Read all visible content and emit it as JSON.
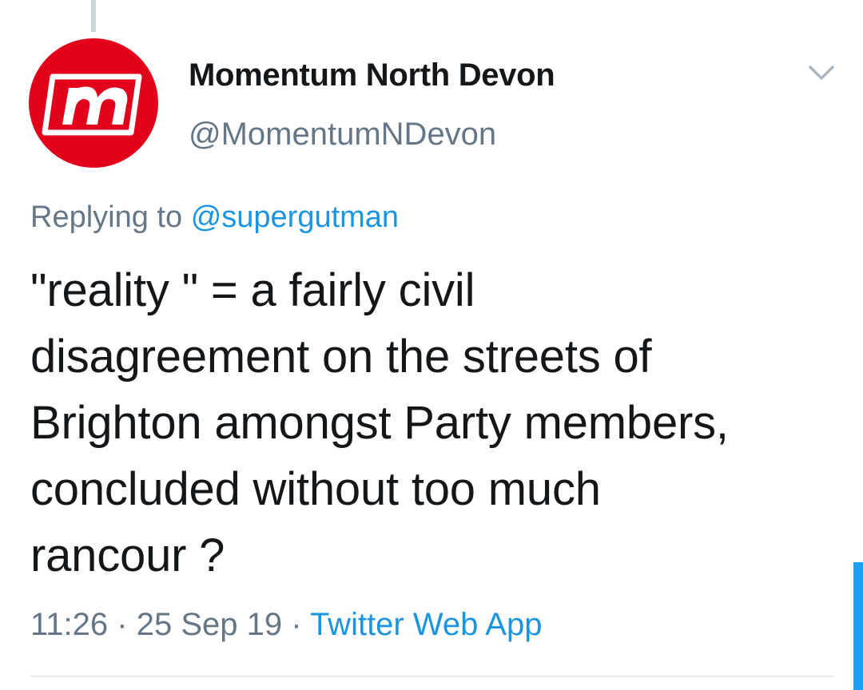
{
  "tweet": {
    "author": {
      "display_name": "Momentum North Devon",
      "handle": "@MomentumNDevon",
      "avatar_icon": "momentum-logo-icon",
      "brand_color": "#e2001a"
    },
    "reply": {
      "prefix": "Replying to",
      "mention": "@supergutman"
    },
    "text_lines": [
      "\"reality \" = a fairly civil",
      "disagreement on the streets of",
      "Brighton amongst Party members,",
      "concluded without too much",
      "rancour ?"
    ],
    "time": "11:26",
    "date": "25 Sep 19",
    "separator": "·",
    "source": "Twitter Web App"
  },
  "icons": {
    "menu": "chevron-down-icon"
  },
  "colors": {
    "link": "#1b95e0",
    "secondary_text": "#657786",
    "primary_text": "#14171a",
    "scrollbar": "#1da1f2"
  }
}
